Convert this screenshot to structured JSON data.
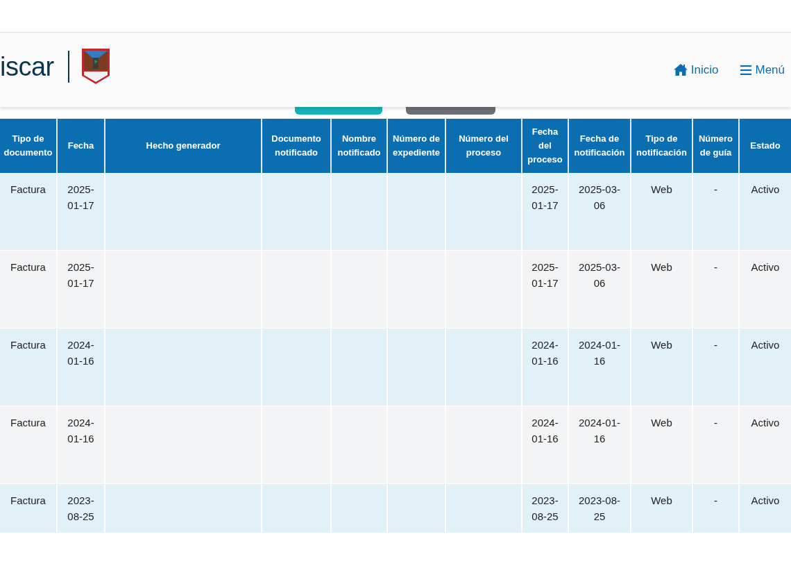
{
  "header": {
    "logo_text": "iscar",
    "nav": [
      {
        "kind": "home",
        "label": "Inicio"
      },
      {
        "kind": "menu",
        "label": "Menú"
      }
    ]
  },
  "toolbar_buttons": [
    {
      "color": "#17b3b6"
    },
    {
      "color": "#6c7075"
    }
  ],
  "table": {
    "columns": [
      "Tipo de documento",
      "Fecha",
      "Hecho generador",
      "Documento notificado",
      "Nombre notificado",
      "Número de expediente",
      "Número del proceso",
      "Fecha del proceso",
      "Fecha de notificación",
      "Tipo de notificación",
      "Número de guía",
      "Estado"
    ],
    "rows": [
      {
        "cells": [
          "Factura",
          "2025-01-17",
          null,
          null,
          null,
          null,
          null,
          "2025-01-17",
          "2025-03-06",
          "Web",
          "-",
          "Activo"
        ]
      },
      {
        "cells": [
          "Factura",
          "2025-01-17",
          null,
          null,
          null,
          null,
          null,
          "2025-01-17",
          "2025-03-06",
          "Web",
          "-",
          "Activo"
        ]
      },
      {
        "cells": [
          "Factura",
          "2024-01-16",
          null,
          null,
          null,
          null,
          null,
          "2024-01-16",
          "2024-01-16",
          "Web",
          "-",
          "Activo"
        ]
      },
      {
        "cells": [
          "Factura",
          "2024-01-16",
          null,
          null,
          null,
          null,
          null,
          "2024-01-16",
          "2024-01-16",
          "Web",
          "-",
          "Activo"
        ]
      },
      {
        "cells": [
          "Factura",
          "2023-08-25",
          null,
          null,
          null,
          null,
          null,
          "2023-08-25",
          "2023-08-25",
          "Web",
          "-",
          "Activo"
        ]
      }
    ]
  }
}
